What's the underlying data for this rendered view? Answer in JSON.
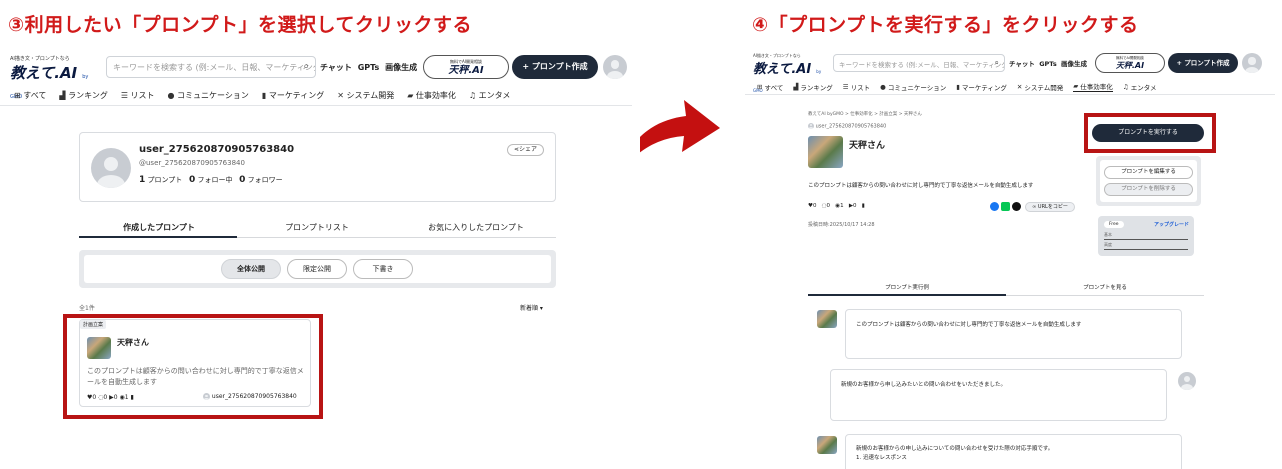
{
  "step3": {
    "title": "③利用したい「プロンプト」を選択してクリックする",
    "logo": {
      "tagline": "AI描き文・プロンプトなら",
      "name": "教えて.AI",
      "suffix": "by GMO"
    },
    "search_placeholder": "キーワードを検索する (例:メール、日報、マーケティング)",
    "nav": {
      "chat": "チャット",
      "gpts": "GPTs",
      "image": "画像生成"
    },
    "banner": {
      "top": "無料でAI開発相談",
      "main": "天秤.AI"
    },
    "create_button": "+ プロンプト作成",
    "categories": [
      "すべて",
      "ランキング",
      "リスト",
      "コミュニケーション",
      "マーケティング",
      "システム開発",
      "仕事効率化",
      "エンタメ"
    ],
    "profile": {
      "username": "user_275620870905763840",
      "handle": "@user_275620870905763840",
      "prompts_count": "1",
      "prompts_label": "プロンプト",
      "following_count": "0",
      "following_label": "フォロー中",
      "followers_count": "0",
      "followers_label": "フォロワー",
      "share_label": "シェア"
    },
    "tabs": [
      "作成したプロンプト",
      "プロンプトリスト",
      "お気に入りしたプロンプト"
    ],
    "filters": [
      "全体公開",
      "限定公開",
      "下書き"
    ],
    "result_count": "全1件",
    "sort_label": "新着順 ▾",
    "prompt_card": {
      "tag": "計画立案",
      "title": "天秤さん",
      "description": "このプロンプトは顧客からの問い合わせに対し専門的で丁寧な返信メールを自動生成します",
      "likes": "0",
      "comments": "0",
      "runs": "0",
      "views": "1",
      "author": "user_275620870905763840"
    }
  },
  "step4": {
    "title": "④「プロンプトを実行する」をクリックする",
    "logo": {
      "tagline": "AI描き文・プロンプトなら",
      "name": "教えて.AI",
      "suffix": "by GMO"
    },
    "search_placeholder": "キーワードを検索する (例:メール、日報、マーケティング)",
    "nav": {
      "chat": "チャット",
      "gpts": "GPTs",
      "image": "画像生成"
    },
    "banner": {
      "top": "無料でAI開発相談",
      "main": "天秤.AI"
    },
    "create_button": "+ プロンプト作成",
    "categories": [
      "すべて",
      "ランキング",
      "リスト",
      "コミュニケーション",
      "マーケティング",
      "システム開発",
      "仕事効率化",
      "エンタメ"
    ],
    "breadcrumb": "教えてAI byGMO > 仕事効率化 > 計画立案 > 天秤さん",
    "author": "user_275620870905763840",
    "prompt_title": "天秤さん",
    "description": "このプロンプトは顧客からの問い合わせに対し専門的で丁寧な返信メールを自動生成します",
    "stats": {
      "likes": "0",
      "comments": "0",
      "views": "1",
      "runs": "0"
    },
    "copy_url": "URLをコピー",
    "posted": "投稿日時:2025/10/17 14:28",
    "run_button": "プロンプトを実行する",
    "edit_button": "プロンプトを編集する",
    "delete_button": "プロンプトを削除する",
    "plan": {
      "badge": "Free",
      "upgrade": "アップグレード",
      "row1": "基本",
      "row2": "高度"
    },
    "tabs": [
      "プロンプト実行例",
      "プロンプトを見る"
    ],
    "chat": [
      "このプロンプトは顧客からの問い合わせに対し専門的で丁寧な返信メールを自動生成します",
      "新規のお客様から申し込みたいとの問い合わせをいただきました。",
      "新規のお客様からの申し込みについての問い合わせを受けた際の対応手順です。",
      "1. 迅速なレスポンス"
    ]
  },
  "colors": {
    "title_red": "#d11a1a",
    "highlight_red": "#b81414",
    "dark_button": "#1f2a3a",
    "arrow_red": "#c41010"
  }
}
